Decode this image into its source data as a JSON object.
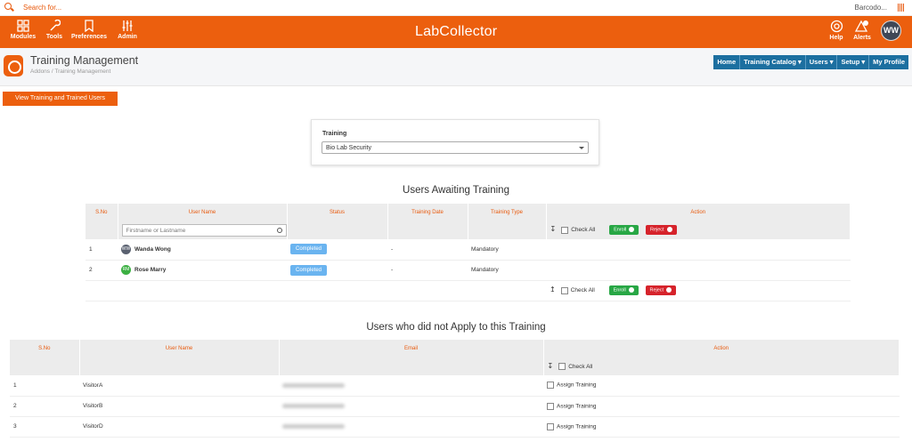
{
  "search": {
    "placeholder": "Search for...",
    "barcode_label": "Barcodo..."
  },
  "topnav": {
    "items": [
      {
        "label": "Modules",
        "icon": "grid-icon"
      },
      {
        "label": "Tools",
        "icon": "wrench-icon"
      },
      {
        "label": "Preferences",
        "icon": "bookmark-icon"
      },
      {
        "label": "Admin",
        "icon": "sliders-icon"
      }
    ],
    "logo": "LabCollector",
    "help_label": "Help",
    "alerts_label": "Alerts",
    "alerts_count": "0",
    "avatar_initials": "WW"
  },
  "header": {
    "title": "Training Management",
    "breadcrumb": "Addons / Training Management",
    "menu": [
      "Home",
      "Training Catalog ▾",
      "Users ▾",
      "Setup ▾",
      "My Profile"
    ]
  },
  "view_button": "View Training and Trained Users",
  "training_select": {
    "label": "Training",
    "value": "Bio Lab Security"
  },
  "awaiting": {
    "title": "Users Awaiting Training",
    "columns": [
      "S.No",
      "User Name",
      "Status",
      "Training Date",
      "Training Type",
      "Action"
    ],
    "filter_placeholder": "Firstname or Lastname",
    "check_all": "Check All",
    "enroll": "Enroll",
    "reject": "Reject",
    "rows": [
      {
        "sno": "1",
        "initials": "WW",
        "name": "Wanda Wong",
        "status": "Completed",
        "date": "-",
        "type": "Mandatory",
        "avatar_color": "#5a6170"
      },
      {
        "sno": "2",
        "initials": "RM",
        "name": "Rose Marry",
        "status": "Completed",
        "date": "-",
        "type": "Mandatory",
        "avatar_color": "#3cb043"
      }
    ]
  },
  "not_applied": {
    "title": "Users who did not Apply to this Training",
    "columns": [
      "S.No",
      "User Name",
      "Email",
      "Action"
    ],
    "check_all": "Check All",
    "assign": "Assign Training",
    "rows": [
      {
        "sno": "1",
        "name": "VisitorA"
      },
      {
        "sno": "2",
        "name": "VisitorB"
      },
      {
        "sno": "3",
        "name": "VisitorD"
      }
    ]
  },
  "colors": {
    "brand": "#ec5f0e",
    "menu": "#1c6fa0",
    "enroll": "#28a745",
    "reject": "#d6232b",
    "completed": "#6ab4f0"
  }
}
